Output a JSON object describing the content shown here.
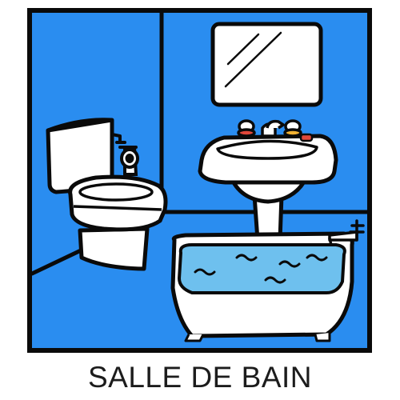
{
  "caption": "SALLE DE BAIN",
  "colors": {
    "background": "#2a8df0",
    "outline": "#0a0a0a",
    "fixture": "#ffffff",
    "water": "#6ec0ee",
    "mirror": "#ffffff",
    "tap_accent_red": "#e0473a",
    "tap_accent_yellow": "#f2b233"
  },
  "icons": [
    "toilet-icon",
    "toilet-paper-icon",
    "mirror-icon",
    "sink-icon",
    "faucet-icon",
    "bathtub-icon",
    "bath-tap-icon"
  ]
}
